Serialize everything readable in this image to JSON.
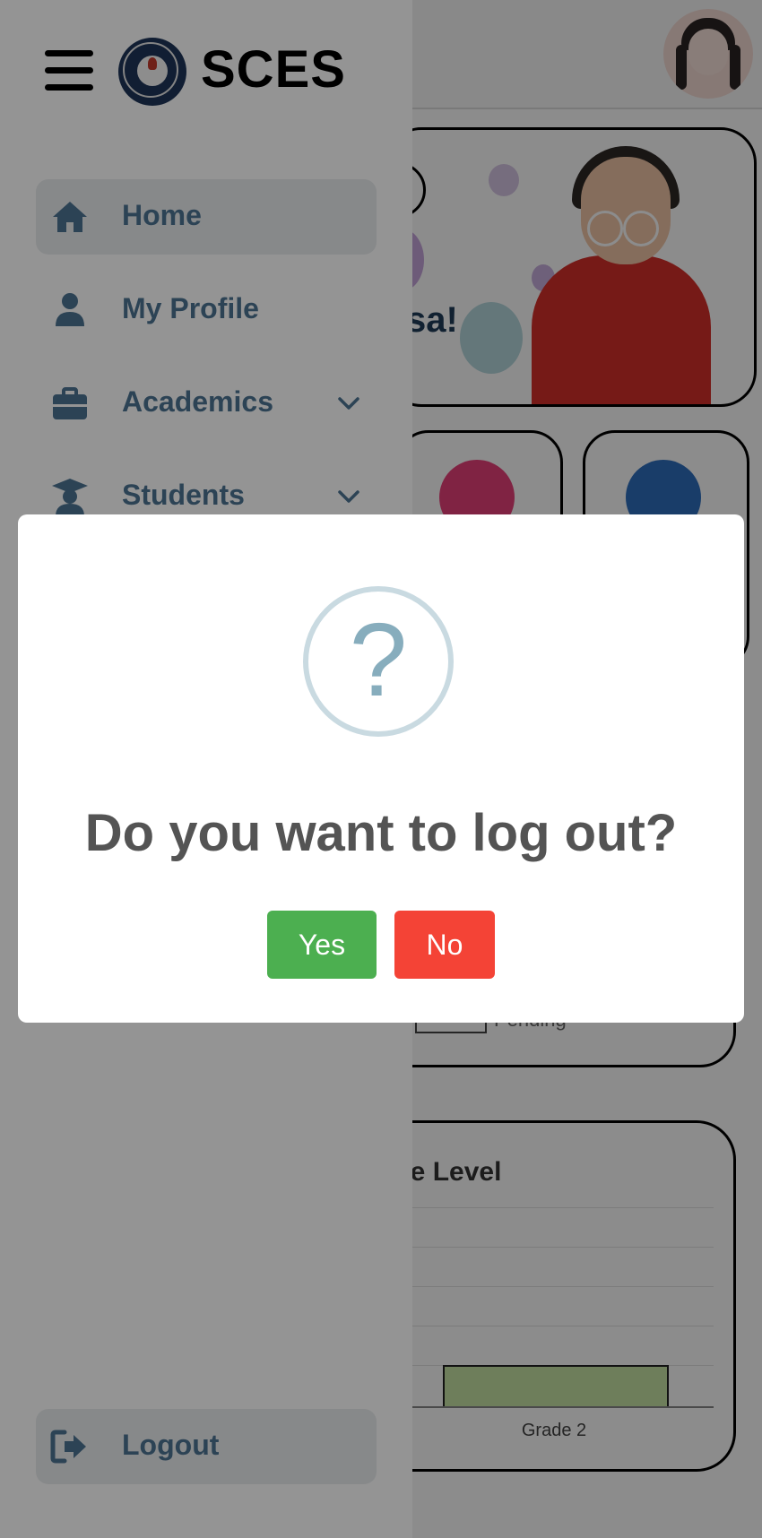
{
  "app": {
    "brand": "SCES"
  },
  "sidebar": {
    "items": [
      {
        "label": "Home"
      },
      {
        "label": "My Profile"
      },
      {
        "label": "Academics"
      },
      {
        "label": "Students"
      }
    ],
    "logout_label": "Logout"
  },
  "dashboard": {
    "greeting_fragment": "sa!",
    "legend_fragment": "Pending",
    "chart_title_fragment": "rade Level",
    "chart_x_label": "Grade 2"
  },
  "dialog": {
    "icon_glyph": "?",
    "title": "Do you want to log out?",
    "yes_label": "Yes",
    "no_label": "No"
  },
  "colors": {
    "nav_text": "#4c7493",
    "active_item_bg": "#e9ecee",
    "yes_button": "#4caf50",
    "no_button": "#f44336",
    "question_icon": "#87adbd"
  }
}
